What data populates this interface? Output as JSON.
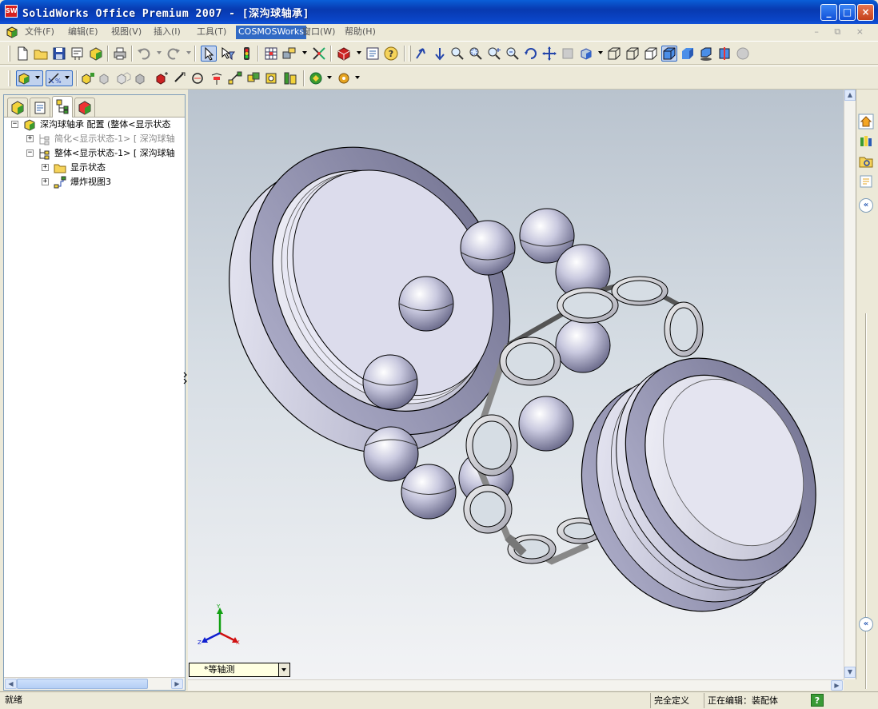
{
  "window": {
    "title": "SolidWorks Office Premium 2007 - [深沟球轴承]",
    "app_icon_text": "SW",
    "controls": {
      "minimize": "_",
      "maximize": "□",
      "close": "×"
    }
  },
  "menu": {
    "items": [
      "文件(F)",
      "编辑(E)",
      "视图(V)",
      "插入(I)",
      "工具(T)",
      "COSMOSWorks",
      "窗口(W)",
      "帮助(H)"
    ],
    "active_index": 5,
    "mdi_controls": "– ⧉ ×"
  },
  "feature_tree": {
    "root": "深沟球轴承 配置  (整体<显示状态",
    "items": [
      {
        "label": "简化<显示状态-1> [ 深沟球轴",
        "dimmed": true
      },
      {
        "label": "整体<显示状态-1> [ 深沟球轴",
        "dimmed": false
      },
      {
        "label": "显示状态",
        "dimmed": false
      },
      {
        "label": "爆炸视图3",
        "dimmed": false
      }
    ]
  },
  "viewport": {
    "view_orientation": "*等轴测",
    "triad": {
      "x": "X",
      "y": "Y",
      "z": "Z"
    },
    "icons": [
      "bearing-outer-ring",
      "bearing-balls",
      "bearing-cage",
      "bearing-inner-ring"
    ]
  },
  "status_bar": {
    "left": "就绪",
    "definition": "完全定义",
    "editing": "正在编辑：装配体",
    "help": "?"
  },
  "colors": {
    "titlebar": "#0839b0",
    "menu_active": "#316ac5",
    "part_face": "#c4c4d8",
    "part_shadow": "#7a7a98"
  }
}
